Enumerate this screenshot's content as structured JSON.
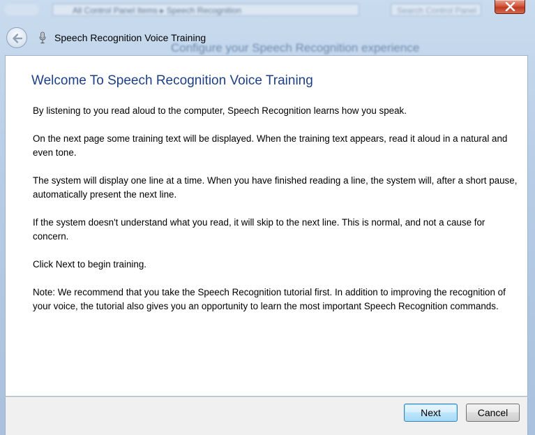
{
  "window": {
    "title": "Speech Recognition Voice Training",
    "background_address": "All Control Panel Items  ▸  Speech Recognition",
    "background_search": "Search Control Panel",
    "background_heading": "Configure your Speech Recognition experience"
  },
  "content": {
    "heading": "Welcome To Speech Recognition Voice Training",
    "paragraphs": [
      "By listening to you read aloud to the computer, Speech Recognition learns how you speak.",
      "On the next page some training text will be displayed. When the training text appears, read it aloud in a natural and even tone.",
      "The system will display one line at a time. When you have finished reading a line, the system will, after a short pause, automatically present the next line.",
      "If the system doesn't understand what you read, it will skip to the next line. This is normal, and not a cause for concern.",
      "Click Next to begin training.",
      "Note: We recommend that you take the Speech Recognition tutorial first. In addition to improving the recognition of your voice, the tutorial also gives you an opportunity to learn the most important Speech Recognition commands."
    ]
  },
  "buttons": {
    "next_label": "Next",
    "cancel_label": "Cancel"
  },
  "icons": {
    "close": "close-icon",
    "back": "back-arrow-icon",
    "microphone": "microphone-icon"
  },
  "colors": {
    "heading": "#1e3f86",
    "close_button": "#c94a30",
    "default_button_border": "#3c7fb1"
  }
}
